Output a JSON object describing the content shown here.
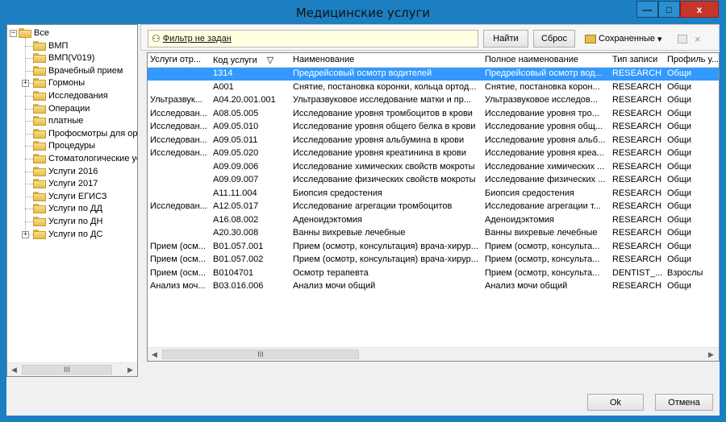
{
  "window": {
    "title": "Медицинские услуги",
    "controls": {
      "minimize": "—",
      "maximize": "□",
      "close": "x"
    }
  },
  "tree": {
    "root": "Все",
    "items": [
      {
        "label": "ВМП",
        "expandable": false
      },
      {
        "label": "ВМП(V019)",
        "expandable": false
      },
      {
        "label": "Врачебный прием",
        "expandable": false
      },
      {
        "label": "Гормоны",
        "expandable": true
      },
      {
        "label": "Исследования",
        "expandable": false
      },
      {
        "label": "Операции",
        "expandable": false
      },
      {
        "label": "платные",
        "expandable": false
      },
      {
        "label": "Профосмотры для орг",
        "expandable": false
      },
      {
        "label": "Процедуры",
        "expandable": false
      },
      {
        "label": "Стоматологические ус",
        "expandable": false
      },
      {
        "label": "Услуги 2016",
        "expandable": false
      },
      {
        "label": "Услуги 2017",
        "expandable": false
      },
      {
        "label": "Услуги ЕГИСЗ",
        "expandable": false
      },
      {
        "label": "Услуги по ДД",
        "expandable": false
      },
      {
        "label": "Услуги по ДН",
        "expandable": false
      },
      {
        "label": "Услуги по ДС",
        "expandable": true
      }
    ],
    "scroll_thumb": "III"
  },
  "toolbar": {
    "filter_text": "Фильтр не задан",
    "find_label": "Найти",
    "reset_label": "Сброс",
    "saved_label": "Сохраненные",
    "dropdown_arrow": "▾",
    "clear_label": "×"
  },
  "grid": {
    "columns": [
      "Услуги отр...",
      "Код услуги",
      "Наименование",
      "Полное наименование",
      "Тип записи",
      "Профиль у..."
    ],
    "sort_indicator": "▽",
    "rows": [
      {
        "c0": "",
        "c1": "1314",
        "c2": "Предрейсовый осмотр водителей",
        "c3": "Предрейсовый осмотр вод...",
        "c4": "RESEARCH",
        "c5": "Общи",
        "selected": true
      },
      {
        "c0": "",
        "c1": "A001",
        "c2": "Снятие, постановка коронки, кольца ортод...",
        "c3": "Снятие, постановка корон...",
        "c4": "RESEARCH",
        "c5": "Общи"
      },
      {
        "c0": "Ультразвук...",
        "c1": "A04.20.001.001",
        "c2": "Ультразвуковое исследование матки и пр...",
        "c3": "Ультразвуковое исследов...",
        "c4": "RESEARCH",
        "c5": "Общи"
      },
      {
        "c0": "Исследован...",
        "c1": "A08.05.005",
        "c2": "Исследование уровня тромбоцитов в крови",
        "c3": "Исследование уровня тро...",
        "c4": "RESEARCH",
        "c5": "Общи"
      },
      {
        "c0": "Исследован...",
        "c1": "A09.05.010",
        "c2": "Исследование уровня общего белка в крови",
        "c3": "Исследование уровня общ...",
        "c4": "RESEARCH",
        "c5": "Общи"
      },
      {
        "c0": "Исследован...",
        "c1": "A09.05.011",
        "c2": "Исследование уровня альбумина в крови",
        "c3": "Исследование уровня альб...",
        "c4": "RESEARCH",
        "c5": "Общи"
      },
      {
        "c0": "Исследован...",
        "c1": "A09.05.020",
        "c2": "Исследование уровня креатинина в крови",
        "c3": "Исследование уровня креа...",
        "c4": "RESEARCH",
        "c5": "Общи"
      },
      {
        "c0": "",
        "c1": "A09.09.006",
        "c2": "Исследование химических свойств мокроты",
        "c3": "Исследование химических ...",
        "c4": "RESEARCH",
        "c5": "Общи"
      },
      {
        "c0": "",
        "c1": "A09.09.007",
        "c2": "Исследование физических свойств мокроты",
        "c3": "Исследование физических ...",
        "c4": "RESEARCH",
        "c5": "Общи"
      },
      {
        "c0": "",
        "c1": "A11.11.004",
        "c2": "Биопсия средостения",
        "c3": "Биопсия средостения",
        "c4": "RESEARCH",
        "c5": "Общи"
      },
      {
        "c0": "Исследован...",
        "c1": "A12.05.017",
        "c2": "Исследование агрегации тромбоцитов",
        "c3": "Исследование агрегации т...",
        "c4": "RESEARCH",
        "c5": "Общи"
      },
      {
        "c0": "",
        "c1": "A16.08.002",
        "c2": "Аденоидэктомия",
        "c3": "Аденоидэктомия",
        "c4": "RESEARCH",
        "c5": "Общи"
      },
      {
        "c0": "",
        "c1": "A20.30.008",
        "c2": "Ванны вихревые лечебные",
        "c3": "Ванны вихревые лечебные",
        "c4": "RESEARCH",
        "c5": "Общи"
      },
      {
        "c0": "Прием (осм...",
        "c1": "B01.057.001",
        "c2": "Прием (осмотр, консультация) врача-хирур...",
        "c3": "Прием (осмотр, консульта...",
        "c4": "RESEARCH",
        "c5": "Общи"
      },
      {
        "c0": "Прием (осм...",
        "c1": "B01.057.002",
        "c2": "Прием (осмотр, консультация) врача-хирур...",
        "c3": "Прием (осмотр, консульта...",
        "c4": "RESEARCH",
        "c5": "Общи"
      },
      {
        "c0": "Прием (осм...",
        "c1": "B0104701",
        "c2": "Осмотр терапевта",
        "c3": "Прием (осмотр, консульта...",
        "c4": "DENTIST_...",
        "c5": "Взрослы"
      },
      {
        "c0": "Анализ моч...",
        "c1": "B03.016.006",
        "c2": "Анализ мочи общий",
        "c3": "Анализ мочи общий",
        "c4": "RESEARCH",
        "c5": "Общи"
      }
    ],
    "scroll_thumb": "III"
  },
  "footer": {
    "ok_label": "Ok",
    "cancel_label": "Отмена"
  },
  "colors": {
    "title_bar": "#1c7fc1",
    "selection": "#3399ff",
    "filter_bg": "#ffffe1",
    "close_button": "#c7362b"
  }
}
